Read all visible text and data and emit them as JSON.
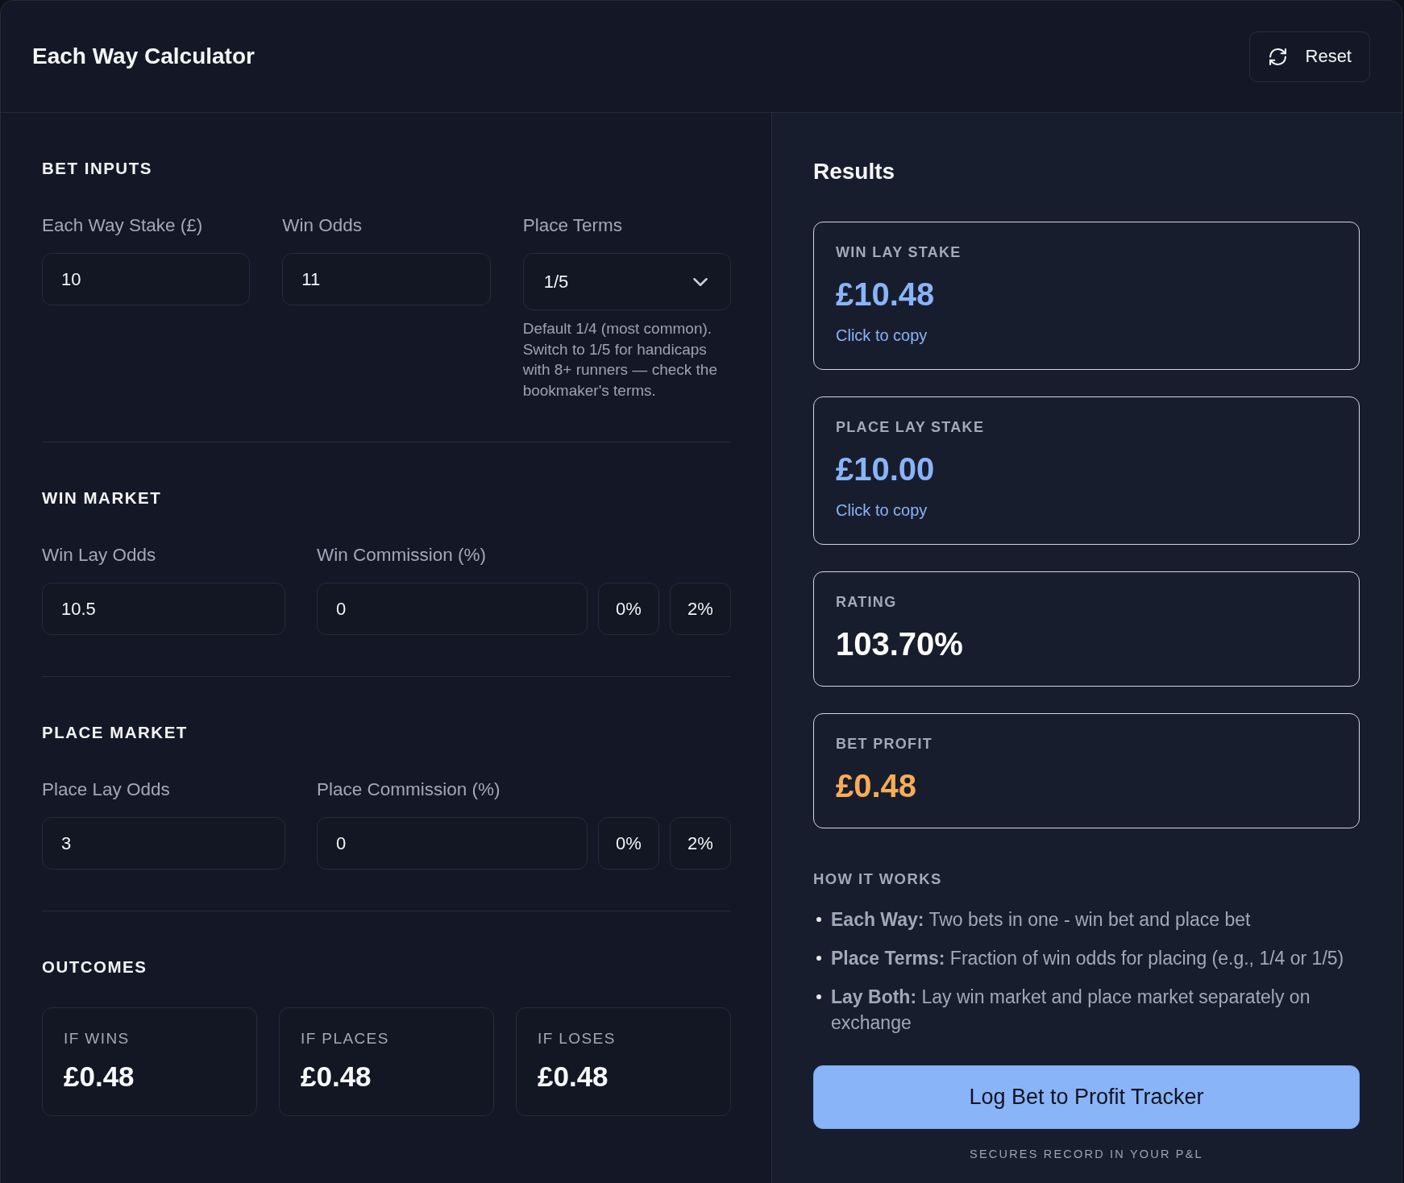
{
  "header": {
    "title": "Each Way Calculator",
    "reset_button": "Reset"
  },
  "sections": [
    {
      "kind": "bet_inputs",
      "title": "BET INPUTS",
      "fields": [
        {
          "kind": "input",
          "label": "Each Way Stake (£)",
          "value": "10"
        },
        {
          "kind": "input",
          "label": "Win Odds",
          "value": "11"
        },
        {
          "kind": "select",
          "label": "Place Terms",
          "value": "1/5",
          "hint": "Default 1/4 (most common). Switch to 1/5 for handicaps with 8+ runners — check the bookmaker's terms."
        }
      ]
    },
    {
      "kind": "market",
      "title": "WIN MARKET",
      "odds": {
        "label": "Win Lay Odds",
        "value": "10.5"
      },
      "commission": {
        "label": "Win Commission (%)",
        "value": "0",
        "presets": [
          "0%",
          "2%"
        ]
      }
    },
    {
      "kind": "market",
      "title": "PLACE MARKET",
      "odds": {
        "label": "Place Lay Odds",
        "value": "3"
      },
      "commission": {
        "label": "Place Commission (%)",
        "value": "0",
        "presets": [
          "0%",
          "2%"
        ]
      }
    },
    {
      "kind": "outcomes",
      "title": "OUTCOMES",
      "cards": [
        {
          "label": "IF WINS",
          "value": "£0.48"
        },
        {
          "label": "IF PLACES",
          "value": "£0.48"
        },
        {
          "label": "IF LOSES",
          "value": "£0.48"
        }
      ]
    }
  ],
  "results": {
    "title": "Results",
    "cards": [
      {
        "label": "WIN LAY STAKE",
        "value": "£10.48",
        "color": "#8ab4f8",
        "copy_link": "Click to copy"
      },
      {
        "label": "PLACE LAY STAKE",
        "value": "£10.00",
        "color": "#8ab4f8",
        "copy_link": "Click to copy"
      },
      {
        "label": "RATING",
        "value": "103.70%",
        "color": "#ffffff"
      },
      {
        "label": "BET PROFIT",
        "value": "£0.48",
        "color": "#f6ad55"
      }
    ]
  },
  "how_it_works": {
    "title": "HOW IT WORKS",
    "items": [
      "**Each Way:** Two bets in one - win bet and place bet",
      "**Place Terms:** Fraction of win odds for placing (e.g., 1/4 or 1/5)",
      "**Lay Both:** Lay win market and place market separately on exchange"
    ]
  },
  "log_button": "Log Bet to Profit Tracker",
  "footnote": "SECURES RECORD IN YOUR P&L"
}
